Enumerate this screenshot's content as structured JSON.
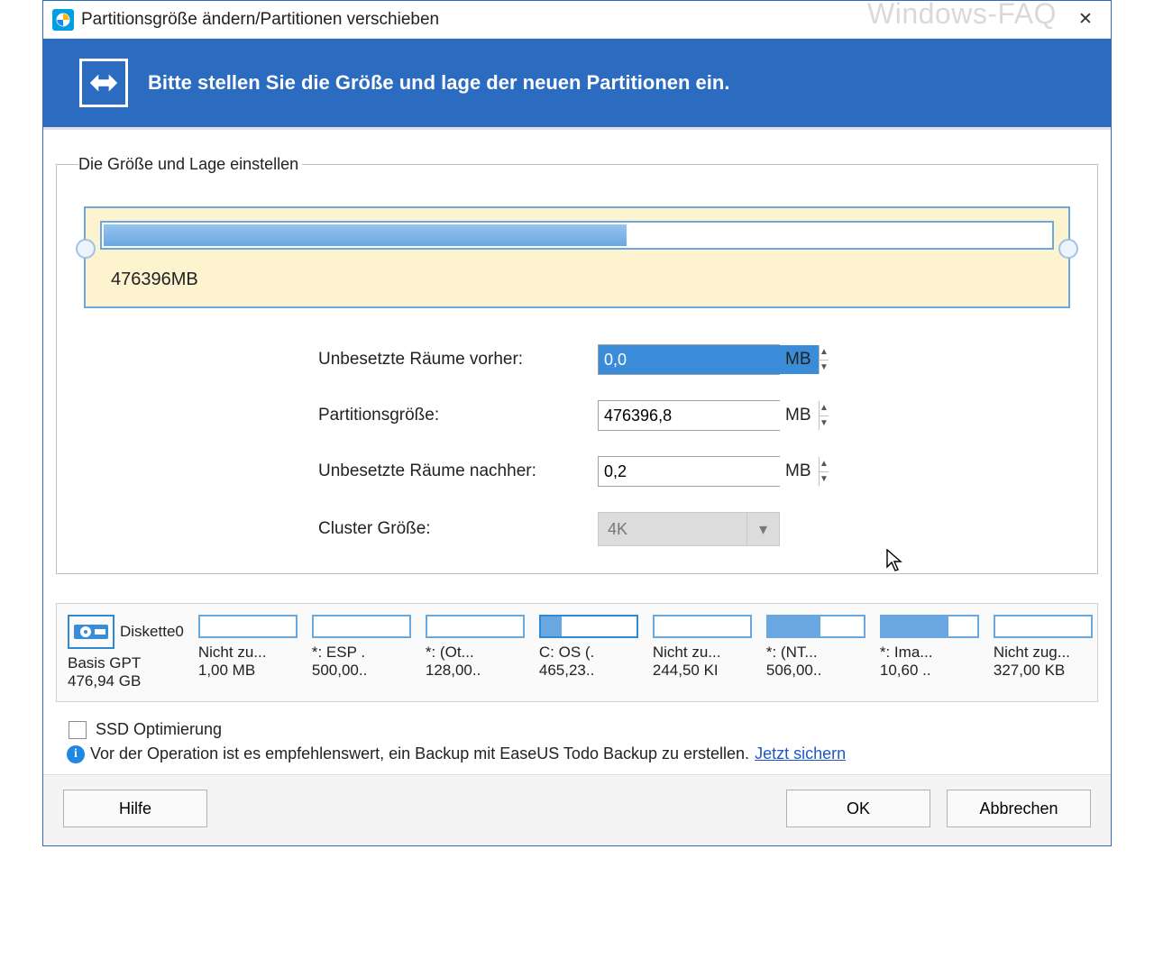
{
  "titlebar": {
    "title": "Partitionsgröße ändern/Partitionen verschieben",
    "watermark": "Windows-FAQ"
  },
  "banner": {
    "text": "Bitte stellen Sie die Größe und lage der neuen Partitionen ein."
  },
  "sizebox": {
    "legend": "Die Größe und Lage einstellen",
    "bar_label": "476396MB",
    "fill_percent": 55,
    "fields": {
      "before_label": "Unbesetzte Räume vorher:",
      "before_value": "0,0",
      "size_label": "Partitionsgröße:",
      "size_value": "476396,8",
      "after_label": "Unbesetzte Räume nachher:",
      "after_value": "0,2",
      "unit": "MB",
      "cluster_label": "Cluster Größe:",
      "cluster_value": "4K"
    }
  },
  "disk": {
    "name": "Diskette0",
    "type": "Basis GPT",
    "capacity": "476,94 GB",
    "partitions": [
      {
        "label": "Nicht zu...",
        "size": "1,00 MB",
        "fill": 0,
        "sel": false
      },
      {
        "label": "*: ESP .",
        "size": "500,00..",
        "fill": 0,
        "sel": false
      },
      {
        "label": "*: (Ot...",
        "size": "128,00..",
        "fill": 0,
        "sel": false
      },
      {
        "label": "C: OS (.",
        "size": "465,23..",
        "fill": 22,
        "sel": true
      },
      {
        "label": "Nicht zu...",
        "size": "244,50 KI",
        "fill": 0,
        "sel": false
      },
      {
        "label": "*: (NT...",
        "size": "506,00..",
        "fill": 55,
        "sel": false
      },
      {
        "label": "*: Ima...",
        "size": "10,60 ..",
        "fill": 70,
        "sel": false
      },
      {
        "label": "Nicht zug...",
        "size": "327,00 KB",
        "fill": 0,
        "sel": false
      }
    ]
  },
  "footer": {
    "ssd_label": "SSD Optimierung",
    "info_text": "Vor der Operation ist es empfehlenswert, ein Backup mit  EaseUS Todo Backup zu erstellen.",
    "info_link": "Jetzt sichern",
    "help": "Hilfe",
    "ok": "OK",
    "cancel": "Abbrechen"
  }
}
